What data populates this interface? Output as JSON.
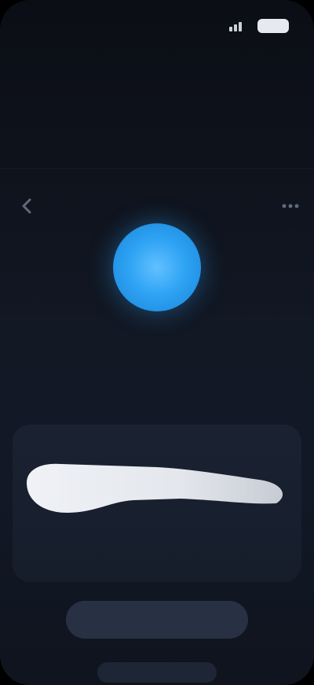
{
  "status_bar": {
    "time": ""
  },
  "header": {
    "title": "",
    "sub_left": "",
    "sub_right": ""
  },
  "nav": {
    "left_icon": "chevron-left-icon",
    "right_icon": "more-icon"
  },
  "profile": {
    "name": "",
    "subtitle": ""
  },
  "card": {
    "label_left": "",
    "label_right": "",
    "label_right_secondary": ""
  },
  "actions": {
    "primary_label": "",
    "secondary_label": ""
  },
  "colors": {
    "accent": "#2fa3f4",
    "background": "#121824",
    "card": "#1a2232",
    "button": "#283143"
  }
}
